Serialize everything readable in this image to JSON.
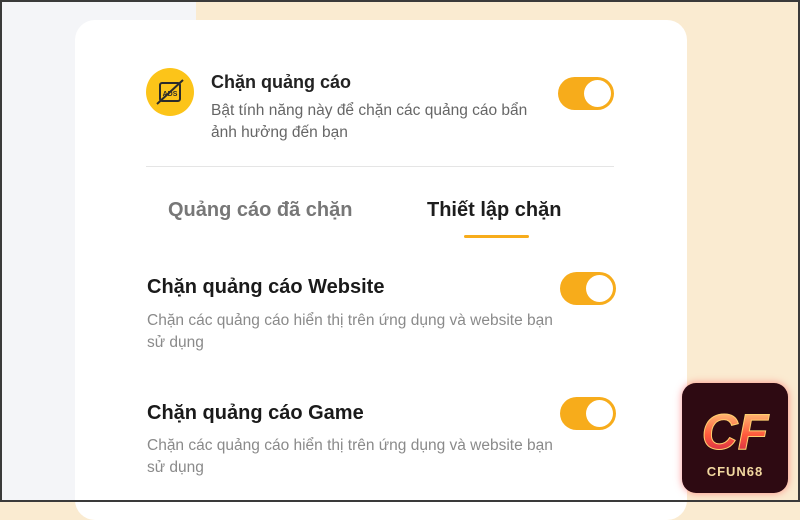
{
  "main_toggle": {
    "icon_text": "ADS",
    "title": "Chặn quảng cáo",
    "description": "Bật tính năng này để chặn các quảng cáo bẩn ảnh hưởng đến bạn",
    "enabled": true
  },
  "tabs": [
    {
      "label": "Quảng cáo đã chặn",
      "active": false
    },
    {
      "label": "Thiết lập chặn",
      "active": true
    }
  ],
  "settings": [
    {
      "title": "Chặn quảng cáo Website",
      "description": "Chặn các quảng cáo hiển thị trên ứng dụng và website bạn sử dụng",
      "enabled": true
    },
    {
      "title": "Chặn quảng cáo Game",
      "description": "Chặn các quảng cáo hiển thị trên ứng dụng và website bạn sử dụng",
      "enabled": true
    }
  ],
  "watermark": {
    "logo_text": "CF",
    "brand_text": "CFUN68"
  },
  "colors": {
    "accent": "#f7ac1b",
    "icon_bg": "#fcc419",
    "backdrop": "#faebd1"
  }
}
